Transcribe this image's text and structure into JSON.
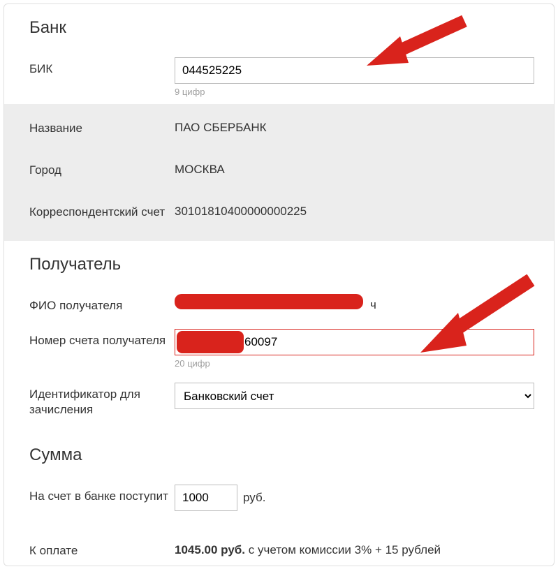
{
  "sections": {
    "bank": {
      "title": "Банк",
      "bik": {
        "label": "БИК",
        "value": "044525225",
        "hint": "9 цифр"
      },
      "name": {
        "label": "Название",
        "value": "ПАО СБЕРБАНК"
      },
      "city": {
        "label": "Город",
        "value": "МОСКВА"
      },
      "corr": {
        "label": "Корреспондентский счет",
        "value": "30101810400000000225"
      }
    },
    "recipient": {
      "title": "Получатель",
      "fio": {
        "label": "ФИО получателя",
        "suffix": "ч"
      },
      "account": {
        "label": "Номер счета получателя",
        "value": "60097",
        "hint": "20 цифр"
      },
      "id_type": {
        "label": "Идентификатор для зачисления",
        "value": "Банковский счет"
      }
    },
    "amount": {
      "title": "Сумма",
      "receive": {
        "label": "На счет в банке поступит",
        "value": "1000",
        "unit": "руб."
      },
      "pay": {
        "label": "К оплате",
        "value": "1045.00 руб.",
        "note": " с учетом комиссии 3% + 15 рублей"
      }
    }
  }
}
